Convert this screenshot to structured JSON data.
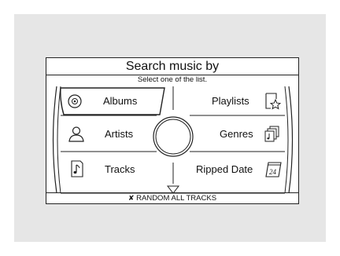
{
  "header": {
    "title": "Search music by",
    "subtitle": "Select one of the list."
  },
  "menu": {
    "left": [
      {
        "label": "Albums",
        "icon": "disc-icon",
        "selected": true
      },
      {
        "label": "Artists",
        "icon": "person-icon",
        "selected": false
      },
      {
        "label": "Tracks",
        "icon": "music-note-icon",
        "selected": false
      }
    ],
    "right": [
      {
        "label": "Playlists",
        "icon": "playlist-star-icon",
        "selected": false
      },
      {
        "label": "Genres",
        "icon": "genres-icon",
        "selected": false
      },
      {
        "label": "Ripped Date",
        "icon": "calendar-icon",
        "selected": false
      }
    ]
  },
  "footer": {
    "random_label": "RANDOM ALL TRACKS",
    "random_icon": "shuffle-icon"
  }
}
